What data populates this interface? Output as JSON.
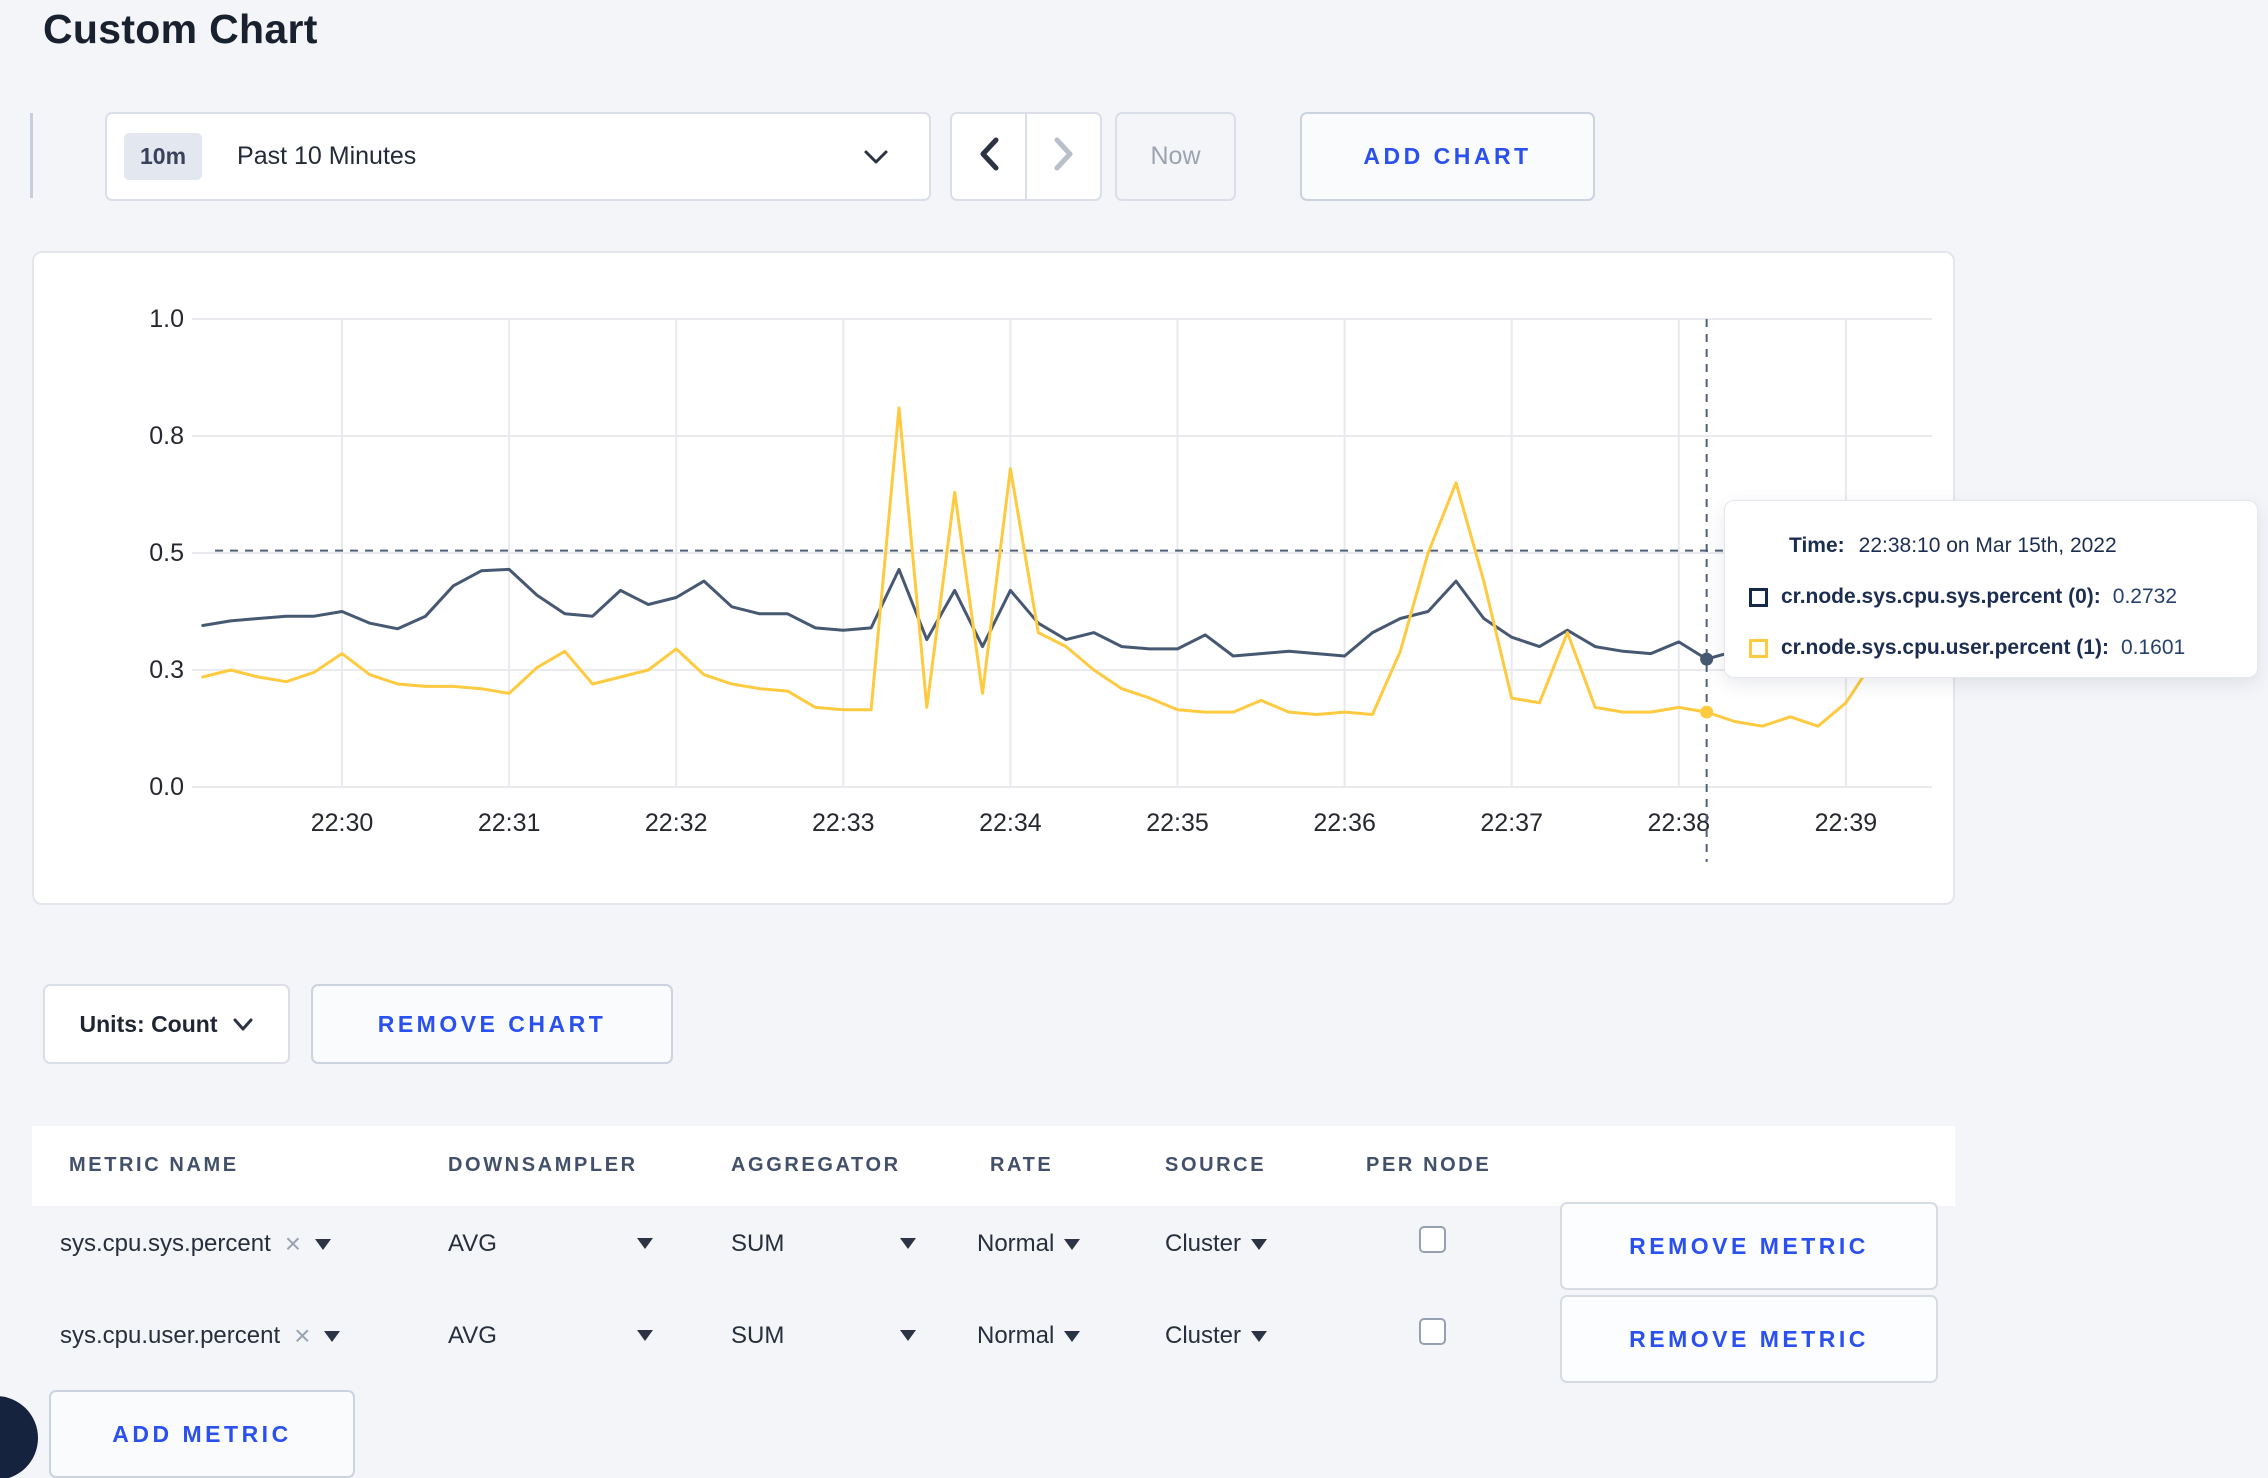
{
  "page": {
    "title": "Custom Chart",
    "accent_blue": "#2a50f0"
  },
  "toolbar": {
    "range_badge": "10m",
    "range_label": "Past 10 Minutes",
    "now_label": "Now",
    "add_chart_label": "ADD CHART"
  },
  "chart_data": {
    "type": "line",
    "title": "",
    "xlabel": "",
    "ylabel": "",
    "ylim": [
      0,
      1
    ],
    "grid": true,
    "x_ticks": [
      "22:30",
      "22:31",
      "22:32",
      "22:33",
      "22:34",
      "22:35",
      "22:36",
      "22:37",
      "22:38",
      "22:39"
    ],
    "y_ticks": [
      {
        "v": 0.0,
        "label": "0.0"
      },
      {
        "v": 0.25,
        "label": "0.3"
      },
      {
        "v": 0.5,
        "label": "0.5"
      },
      {
        "v": 0.75,
        "label": "0.8"
      },
      {
        "v": 1.0,
        "label": "1.0"
      }
    ],
    "start_time": "22:29:10",
    "interval_seconds": 10,
    "series": [
      {
        "name": "cr.node.sys.cpu.sys.percent (0)",
        "color": "#475872",
        "values": [
          0.345,
          0.355,
          0.36,
          0.365,
          0.365,
          0.375,
          0.35,
          0.338,
          0.365,
          0.43,
          0.462,
          0.465,
          0.41,
          0.37,
          0.365,
          0.42,
          0.39,
          0.405,
          0.44,
          0.385,
          0.37,
          0.37,
          0.34,
          0.335,
          0.34,
          0.465,
          0.315,
          0.42,
          0.3,
          0.42,
          0.35,
          0.315,
          0.33,
          0.3,
          0.295,
          0.295,
          0.325,
          0.28,
          0.285,
          0.29,
          0.285,
          0.28,
          0.33,
          0.36,
          0.375,
          0.44,
          0.36,
          0.32,
          0.3,
          0.335,
          0.3,
          0.29,
          0.285,
          0.31,
          0.2732,
          0.29,
          0.3,
          0.31,
          0.3,
          0.295,
          0.3,
          0.31,
          0.295
        ]
      },
      {
        "name": "cr.node.sys.cpu.user.percent (1)",
        "color": "#fdca40",
        "values": [
          0.235,
          0.25,
          0.235,
          0.225,
          0.245,
          0.285,
          0.24,
          0.22,
          0.215,
          0.215,
          0.21,
          0.2,
          0.255,
          0.29,
          0.22,
          0.235,
          0.25,
          0.295,
          0.24,
          0.22,
          0.21,
          0.205,
          0.17,
          0.165,
          0.165,
          0.81,
          0.17,
          0.63,
          0.2,
          0.68,
          0.33,
          0.3,
          0.25,
          0.21,
          0.19,
          0.165,
          0.16,
          0.16,
          0.185,
          0.16,
          0.155,
          0.16,
          0.155,
          0.29,
          0.5,
          0.65,
          0.44,
          0.19,
          0.18,
          0.33,
          0.17,
          0.16,
          0.16,
          0.17,
          0.1601,
          0.14,
          0.13,
          0.15,
          0.13,
          0.18,
          0.27,
          0.245,
          0.27
        ]
      }
    ],
    "crosshair": {
      "time": "22:38:10",
      "point_index": 54,
      "h_line_value": 0.505
    },
    "legend_position": "tooltip"
  },
  "tooltip": {
    "time_label": "Time:",
    "time_value": "22:38:10 on Mar 15th, 2022",
    "rows": [
      {
        "name": "cr.node.sys.cpu.sys.percent (0):",
        "value": "0.2732",
        "color": "#152847"
      },
      {
        "name": "cr.node.sys.cpu.user.percent (1):",
        "value": "0.1601",
        "color": "#fdca40"
      }
    ]
  },
  "chart_controls": {
    "units_label": "Units: Count",
    "remove_chart_label": "REMOVE CHART"
  },
  "metrics_table": {
    "headers": {
      "metric_name": "METRIC NAME",
      "downsampler": "DOWNSAMPLER",
      "aggregator": "AGGREGATOR",
      "rate": "RATE",
      "source": "SOURCE",
      "per_node": "PER NODE"
    },
    "rows": [
      {
        "name": "sys.cpu.sys.percent",
        "downsampler": "AVG",
        "aggregator": "SUM",
        "rate": "Normal",
        "source": "Cluster",
        "per_node_checked": false,
        "remove_label": "REMOVE METRIC"
      },
      {
        "name": "sys.cpu.user.percent",
        "downsampler": "AVG",
        "aggregator": "SUM",
        "rate": "Normal",
        "source": "Cluster",
        "per_node_checked": false,
        "remove_label": "REMOVE METRIC"
      }
    ],
    "add_metric_label": "ADD METRIC"
  }
}
